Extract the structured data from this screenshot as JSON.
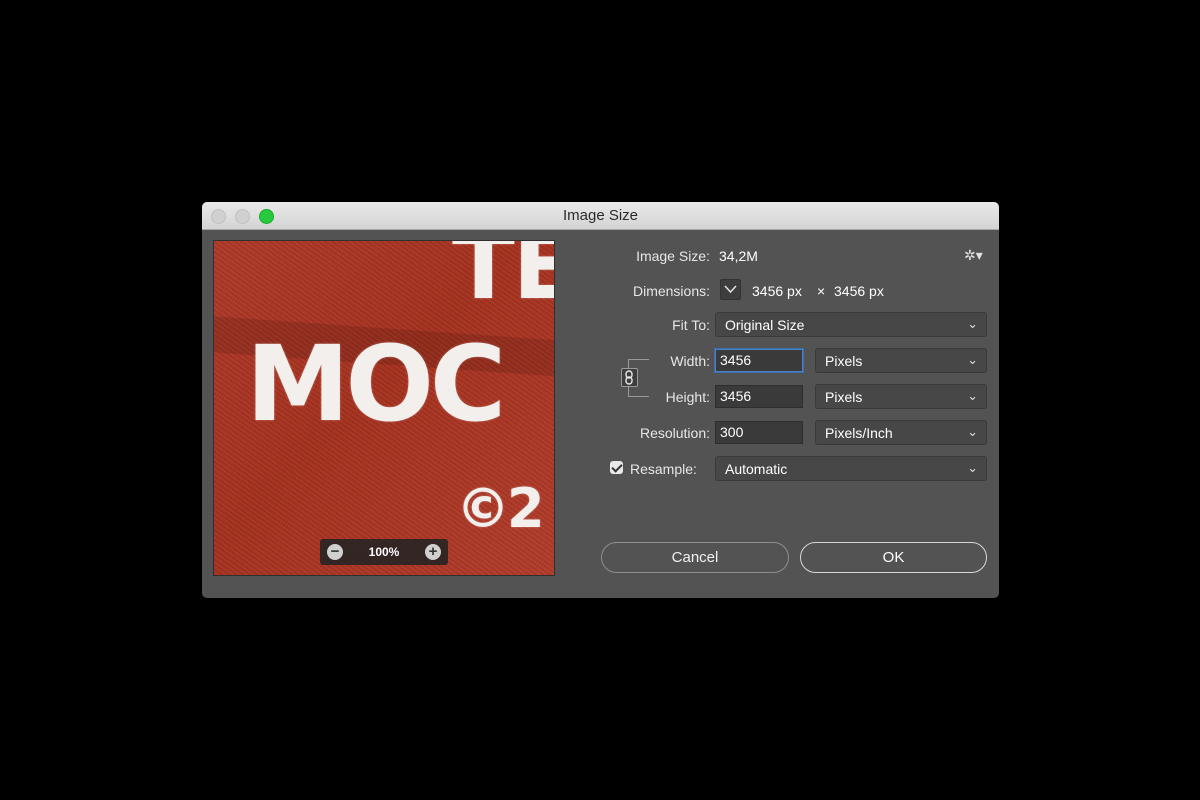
{
  "window": {
    "title": "Image Size"
  },
  "preview": {
    "text_top": "TE",
    "text_mid": "MOC",
    "text_bottom": "©2",
    "zoom_label": "100%"
  },
  "image_size": {
    "label": "Image Size:",
    "value": "34,2M"
  },
  "dimensions": {
    "label": "Dimensions:",
    "width": "3456 px",
    "times": "×",
    "height": "3456 px"
  },
  "fit_to": {
    "label": "Fit To:",
    "selected": "Original Size"
  },
  "width": {
    "label": "Width:",
    "value": "3456",
    "unit": "Pixels"
  },
  "height": {
    "label": "Height:",
    "value": "3456",
    "unit": "Pixels"
  },
  "resolution": {
    "label": "Resolution:",
    "value": "300",
    "unit": "Pixels/Inch"
  },
  "resample": {
    "label": "Resample:",
    "checked": true,
    "selected": "Automatic"
  },
  "buttons": {
    "cancel": "Cancel",
    "ok": "OK"
  }
}
